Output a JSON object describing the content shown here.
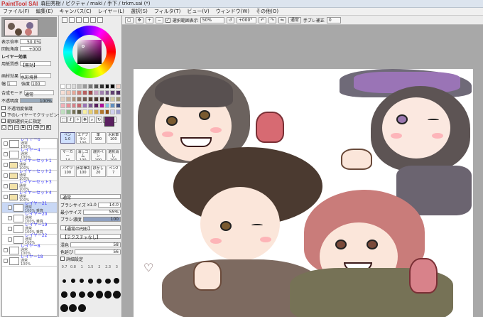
{
  "window": {
    "app": "PaintTool SAI",
    "title": "森田秀樹 / ピクテャ / maki / 手下 / trkm.sai (*)"
  },
  "menu": [
    "ファイル(F)",
    "編集(E)",
    "キャンバス(C)",
    "レイヤー(L)",
    "選択(S)",
    "フィルタ(T)",
    "ビュー(V)",
    "ウィンドウ(W)",
    "その他(O)"
  ],
  "toolbar": {
    "show_selection": "選択範囲表示",
    "zoom": "50%",
    "angle": "+000°",
    "mode": "通常",
    "stabilizer_label": "手ブレ補正",
    "stabilizer": "0"
  },
  "navigator": {
    "zoom_label": "表示倍率",
    "zoom": "50.0%",
    "rotate_label": "回転角度",
    "rotate": "+000"
  },
  "layer_effects": {
    "header": "レイヤー効果",
    "texture_label": "用紙質感",
    "texture": "【無効】",
    "effect_label": "画材効果",
    "effect": "水彩境界",
    "width_label": "幅",
    "width": "1",
    "strength_label": "強度",
    "strength": "100"
  },
  "blend": {
    "label": "合成モード",
    "value": "通常"
  },
  "opacity": {
    "label": "不透明度",
    "value": "100%"
  },
  "options": [
    "不透明度保護",
    "下のレイヤーでクリッピング",
    "範囲選択元に指定"
  ],
  "layers": [
    {
      "name": "レイヤー6",
      "mode": "通常",
      "opacity": "100%"
    },
    {
      "name": "レイヤー4",
      "mode": "通常",
      "opacity": "100%"
    },
    {
      "name": "レイヤーセット1",
      "mode": "通常",
      "opacity": "100%",
      "folder": true
    },
    {
      "name": "レイヤーセット2",
      "mode": "通常",
      "opacity": "100%",
      "folder": true
    },
    {
      "name": "レイヤーセット3",
      "mode": "通常",
      "opacity": "100%",
      "folder": true
    },
    {
      "name": "レイヤーセット4",
      "mode": "通常",
      "opacity": "100%",
      "folder": true
    },
    {
      "name": "レイヤー21",
      "mode": "通常",
      "opacity": "100% 乗算",
      "selected": true
    },
    {
      "name": "レイヤー20",
      "mode": "通常",
      "opacity": "100% 乗算"
    },
    {
      "name": "レイヤー19",
      "mode": "通常",
      "opacity": "100% 乗算"
    },
    {
      "name": "レイヤー22",
      "mode": "通常",
      "opacity": "100%"
    },
    {
      "name": "レイヤー8",
      "mode": "通常",
      "opacity": "100%"
    },
    {
      "name": "レイヤー18",
      "mode": "通常",
      "opacity": "100%"
    }
  ],
  "brushes": [
    {
      "name": "ペン",
      "size": "1.0"
    },
    {
      "name": "エアブラシ",
      "size": "100"
    },
    {
      "name": "筆",
      "size": "100"
    },
    {
      "name": "水彩筆",
      "size": "100"
    },
    {
      "name": "マーカー",
      "size": "14"
    },
    {
      "name": "消しゴム",
      "size": "100"
    },
    {
      "name": "選択ペン",
      "size": "100"
    },
    {
      "name": "選択消し",
      "size": "100"
    },
    {
      "name": "バケツ",
      "size": "100"
    },
    {
      "name": "水彩筆2",
      "size": "100"
    },
    {
      "name": "ぼかし",
      "size": "20"
    },
    {
      "name": "ペン2",
      "size": "7"
    }
  ],
  "brush_props": {
    "mode": "通常",
    "size_label": "ブラシサイズ",
    "size_mult": "x1.0",
    "size": "14.0",
    "min_size_label": "最小サイズ",
    "min_size": "55%",
    "density_label": "ブラシ濃度",
    "density": "100",
    "shape": "【通常の円形】",
    "texture": "【テクスチャなし】",
    "blend_label": "混色",
    "blend": "58",
    "water_label": "色延び",
    "water": "56",
    "keep_opacity": "詳細設定"
  },
  "size_presets": [
    "0.7",
    "0.8",
    "1",
    "1.5",
    "2",
    "2.3",
    "3",
    "3.5",
    "4",
    "5",
    "6",
    "7",
    "8",
    "9",
    "10",
    "12",
    "14",
    "16",
    "20",
    "25",
    "30",
    "35",
    "40",
    "50"
  ],
  "colors": {
    "accent": "#b0119a",
    "selected_color": "#5a2060"
  }
}
